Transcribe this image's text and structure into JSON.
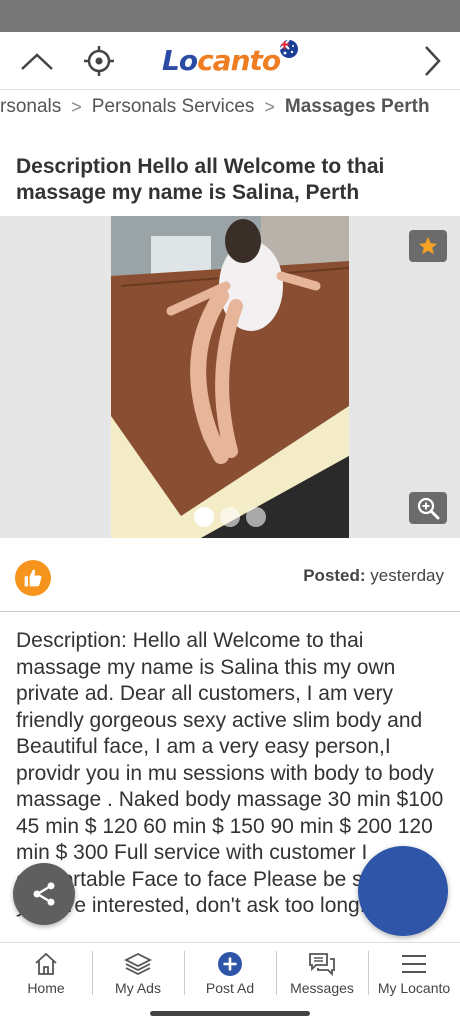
{
  "header": {
    "logo_lo": "Lo",
    "logo_rest": "canto"
  },
  "breadcrumb": {
    "items": [
      "rsonals",
      "Personals Services"
    ],
    "current": "Massages Perth"
  },
  "ad": {
    "title": "Description Hello all Welcome to thai massage my name is Salina, Perth",
    "posted_label": "Posted:",
    "posted_value": " yesterday",
    "description": "Description: Hello all Welcome to thai massage my name is Salina this my own private ad. Dear all customers, I am very friendly gorgeous sexy active slim body and Beautiful face, I am a very easy person,I providr you in mu sessions with body to body massage . Naked body massage 30 min $100 45 min $ 120 60 min $ 150 90 min $ 200 120 min $ 300 Full service with customer I comfortable Face to face Please be serious if you are interested, don't ask too long. I do a"
  },
  "gallery": {
    "image_count": 3,
    "active_index": 0
  },
  "bottom_nav": [
    {
      "label": "Home",
      "icon": "home-icon"
    },
    {
      "label": "My Ads",
      "icon": "layers-icon"
    },
    {
      "label": "Post Ad",
      "icon": "plus-circle-icon"
    },
    {
      "label": "Messages",
      "icon": "messages-icon"
    },
    {
      "label": "My Locanto",
      "icon": "menu-icon"
    }
  ],
  "colors": {
    "brand_blue": "#2b4aa3",
    "brand_orange": "#ef7d22",
    "fab_blue": "#2f55a9",
    "like_orange": "#f7941d"
  }
}
